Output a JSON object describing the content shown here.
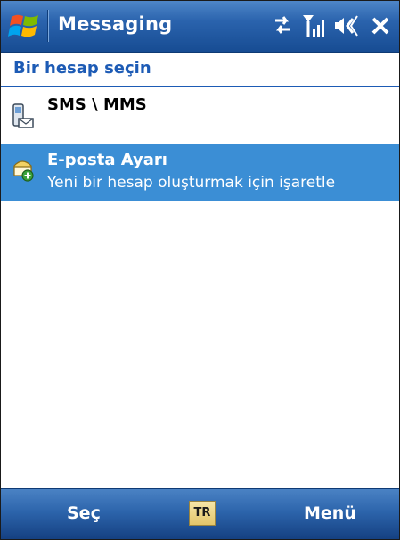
{
  "title_bar": {
    "title": "Messaging",
    "icons": [
      "windows-start-icon",
      "data-connection-icon",
      "signal-strength-icon",
      "speaker-icon",
      "close-icon"
    ]
  },
  "header": {
    "text": "Bir hesap seçin"
  },
  "accounts": [
    {
      "title": "SMS \\ MMS",
      "subtitle": "",
      "icon": "sms-phone-icon",
      "selected": false
    },
    {
      "title": "E-posta Ayarı",
      "subtitle": "Yeni bir hesap oluşturmak için işaretle",
      "icon": "email-add-icon",
      "selected": true
    }
  ],
  "softkeys": {
    "left": "Seç",
    "ime": "TR",
    "right": "Menü"
  },
  "colors": {
    "title_bar": "#2a63ad",
    "header_text": "#1d5bb5",
    "selection": "#3b8ed5"
  }
}
